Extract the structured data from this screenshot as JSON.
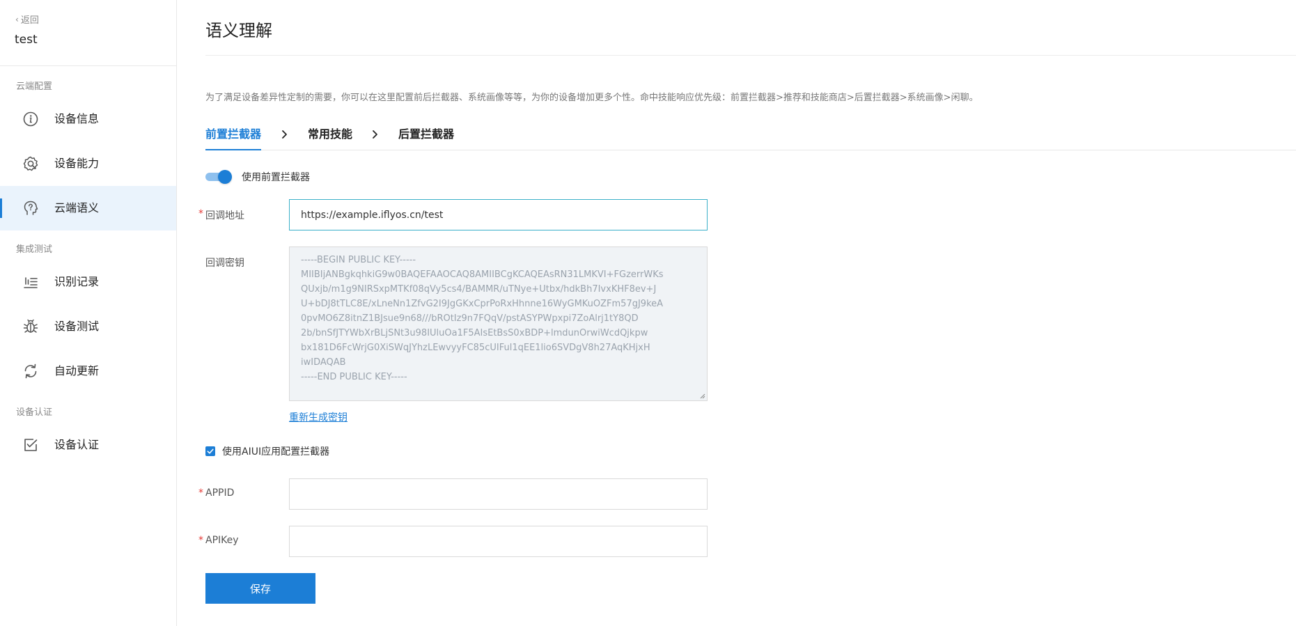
{
  "sidebar": {
    "back_label": "返回",
    "device_name": "test",
    "groups": [
      {
        "title": "云端配置"
      },
      {
        "title": "集成测试"
      },
      {
        "title": "设备认证"
      }
    ],
    "items": [
      {
        "label": "设备信息",
        "icon": "info-circle-icon"
      },
      {
        "label": "设备能力",
        "icon": "gear-capability-icon"
      },
      {
        "label": "云端语义",
        "icon": "semantic-head-icon",
        "active": true
      },
      {
        "label": "识别记录",
        "icon": "record-list-icon"
      },
      {
        "label": "设备测试",
        "icon": "bug-icon"
      },
      {
        "label": "自动更新",
        "icon": "refresh-icon"
      },
      {
        "label": "设备认证",
        "icon": "certificate-check-icon"
      }
    ]
  },
  "main": {
    "title": "语义理解",
    "description": "为了满足设备差异性定制的需要，你可以在这里配置前后拦截器、系统画像等等，为你的设备增加更多个性。命中技能响应优先级：前置拦截器>推荐和技能商店>后置拦截器>系统画像>闲聊。",
    "tabs": [
      {
        "label": "前置拦截器",
        "active": true
      },
      {
        "label": "常用技能"
      },
      {
        "label": "后置拦截器"
      }
    ],
    "toggle_label": "使用前置拦截器",
    "toggle_on": true,
    "callback_label": "回调地址",
    "callback_value": "https://example.iflyos.cn/test",
    "secret_label": "回调密钥",
    "secret_lines": [
      "-----BEGIN PUBLIC KEY-----",
      "MIIBIjANBgkqhkiG9w0BAQEFAAOCAQ8AMIIBCgKCAQEAsRN31LMKVI+FGzerrWKs",
      "QUxjb/m1g9NIRSxpMTKf08qVy5cs4/BAMMR/uTNye+Utbx/hdkBh7IvxKHF8ev+J",
      "U+bDJ8tTLC8E/xLneNn1ZfvG2I9JgGKxCprPoRxHhnne16WyGMKuOZFm57gJ9keA",
      "0pvMO6Z8itnZ1BJsue9n68///bROtIz9n7FQqV/pstASYPWpxpi7ZoAlrj1tY8QD",
      "2b/bnSfJTYWbXrBLjSNt3u98IUluOa1F5AIsEtBsS0xBDP+lmdunOrwiWcdQjkpw",
      "bx181D6FcWrjG0XiSWqJYhzLEwvyyFC85cUIFul1qEE1lio6SVDgV8h27AqKHjxH",
      "iwIDAQAB",
      "-----END PUBLIC KEY-----"
    ],
    "regen_label": "重新生成密钥",
    "checkbox_label": "使用AIUI应用配置拦截器",
    "checkbox_checked": true,
    "appid_label": "APPID",
    "appid_value": "",
    "apikey_label": "APIKey",
    "apikey_value": "",
    "save_label": "保存"
  },
  "colors": {
    "accent": "#1c7ed6",
    "active_bg": "#eaf3fc",
    "required": "#e53935"
  }
}
